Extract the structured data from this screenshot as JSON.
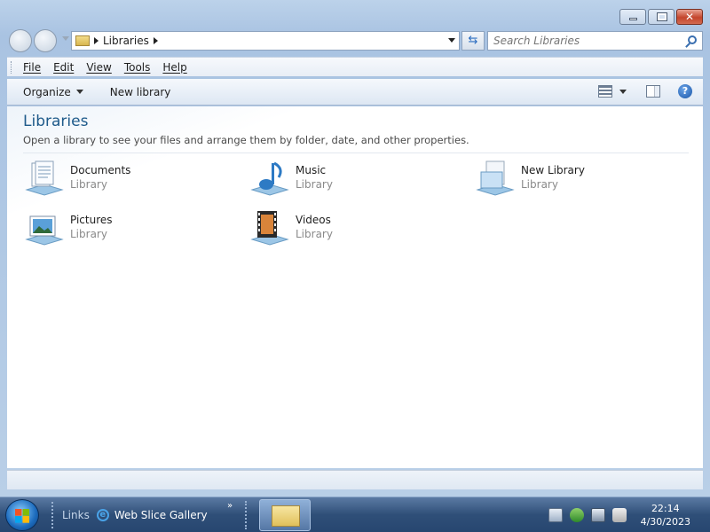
{
  "window": {
    "caption_buttons": {
      "minimize": "minimize",
      "maximize": "maximize",
      "close": "close"
    }
  },
  "address_bar": {
    "path": "Libraries",
    "search_placeholder": "Search Libraries"
  },
  "menu": [
    "File",
    "Edit",
    "View",
    "Tools",
    "Help"
  ],
  "command_bar": {
    "organize": "Organize",
    "new_library": "New library",
    "help_glyph": "?"
  },
  "content": {
    "title": "Libraries",
    "subtitle": "Open a library to see your files and arrange them by folder, date, and other properties.",
    "libraries": [
      {
        "name": "Documents",
        "type": "Library",
        "icon": "documents-library-icon"
      },
      {
        "name": "Music",
        "type": "Library",
        "icon": "music-library-icon"
      },
      {
        "name": "New Library",
        "type": "Library",
        "icon": "new-library-icon"
      },
      {
        "name": "Pictures",
        "type": "Library",
        "icon": "pictures-library-icon"
      },
      {
        "name": "Videos",
        "type": "Library",
        "icon": "videos-library-icon"
      }
    ]
  },
  "taskbar": {
    "links_label": "Links",
    "links_item": "Web Slice Gallery",
    "ie_glyph": "e",
    "chevron": "»",
    "clock_time": "22:14",
    "clock_date": "4/30/2023"
  }
}
